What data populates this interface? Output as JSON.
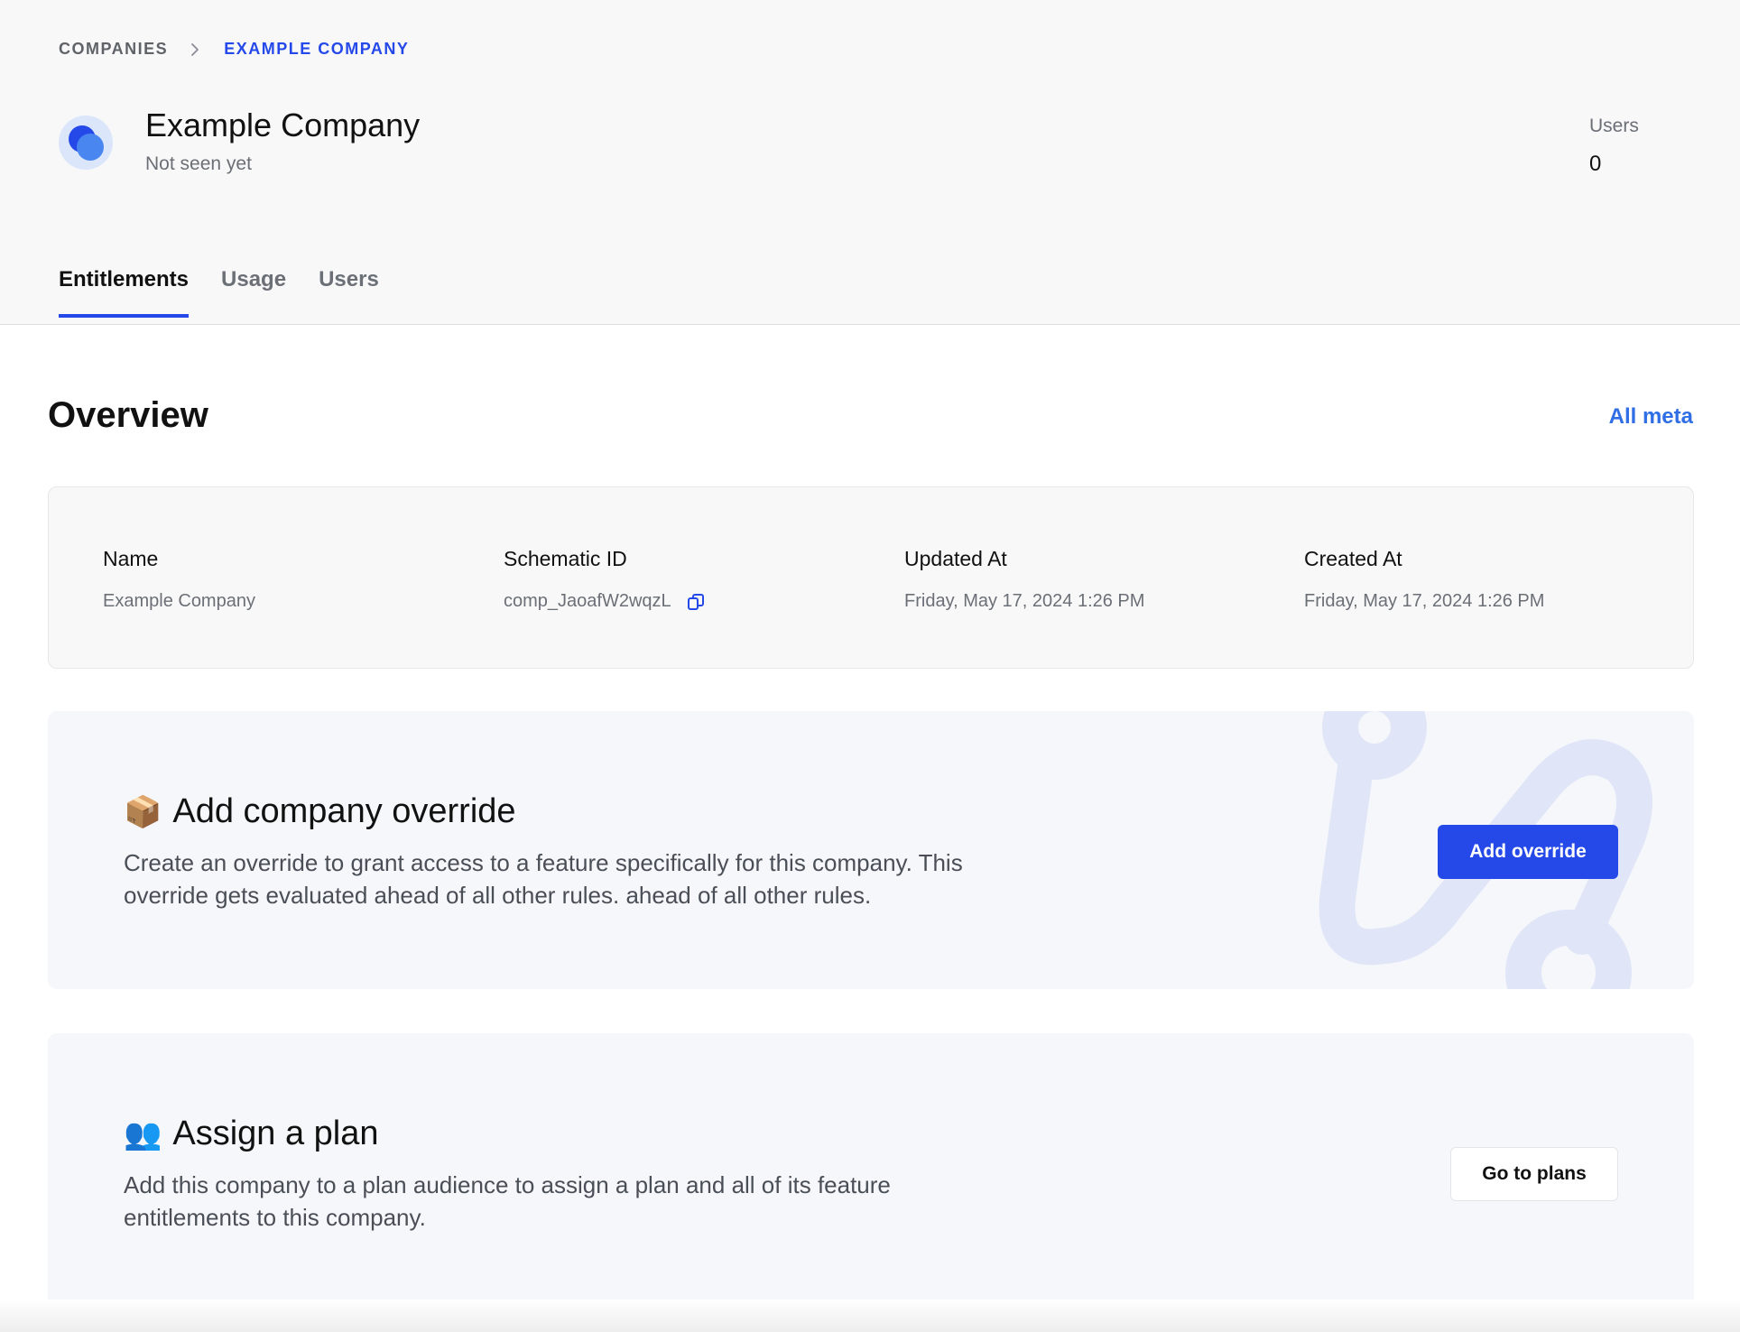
{
  "breadcrumb": {
    "root": "COMPANIES",
    "current": "EXAMPLE COMPANY"
  },
  "company": {
    "name": "Example Company",
    "status": "Not seen yet"
  },
  "stats": {
    "users_label": "Users",
    "users_value": "0"
  },
  "tabs": [
    {
      "label": "Entitlements",
      "active": true
    },
    {
      "label": "Usage",
      "active": false
    },
    {
      "label": "Users",
      "active": false
    }
  ],
  "overview": {
    "title": "Overview",
    "all_meta_label": "All meta",
    "fields": [
      {
        "label": "Name",
        "value": "Example Company"
      },
      {
        "label": "Schematic ID",
        "value": "comp_JaoafW2wqzL"
      },
      {
        "label": "Updated At",
        "value": "Friday, May 17, 2024 1:26 PM"
      },
      {
        "label": "Created At",
        "value": "Friday, May 17, 2024 1:26 PM"
      }
    ]
  },
  "override_cta": {
    "emoji": "📦",
    "title": "Add company override",
    "description": "Create an override to grant access to a feature specifically for this company. This override gets evaluated ahead of all other rules. ahead of all other rules.",
    "button_label": "Add override"
  },
  "plan_cta": {
    "emoji": "👥",
    "title": "Assign a plan",
    "description": "Add this company to a plan audience to assign a plan and all of its feature entitlements to this company.",
    "button_label": "Go to plans"
  },
  "colors": {
    "accent": "#2449e8",
    "link": "#2f6ee5",
    "header_bg": "#f8f8f9",
    "cta_bg": "#f6f7fb"
  }
}
